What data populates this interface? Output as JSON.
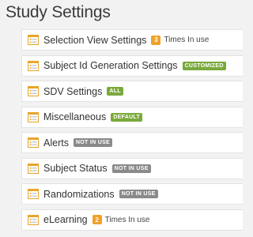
{
  "page": {
    "title": "Study Settings"
  },
  "colors": {
    "icon_accent": "#e8a42a",
    "badge_green": "#7aa93c",
    "badge_gray": "#8a8a8a",
    "count_orange": "#f0a128"
  },
  "items": [
    {
      "label": "Selection View Settings",
      "count": "3",
      "count_label": "Times In use"
    },
    {
      "label": "Subject Id Generation Settings",
      "badge": "CUSTOMIZED",
      "badge_color": "green"
    },
    {
      "label": "SDV Settings",
      "badge": "ALL",
      "badge_color": "green"
    },
    {
      "label": "Miscellaneous",
      "badge": "DEFAULT",
      "badge_color": "green"
    },
    {
      "label": "Alerts",
      "badge": "NOT IN USE",
      "badge_color": "gray"
    },
    {
      "label": "Subject Status",
      "badge": "NOT IN USE",
      "badge_color": "gray"
    },
    {
      "label": "Randomizations",
      "badge": "NOT IN USE",
      "badge_color": "gray"
    },
    {
      "label": "eLearning",
      "count": "2",
      "count_label": "Times In use"
    }
  ]
}
